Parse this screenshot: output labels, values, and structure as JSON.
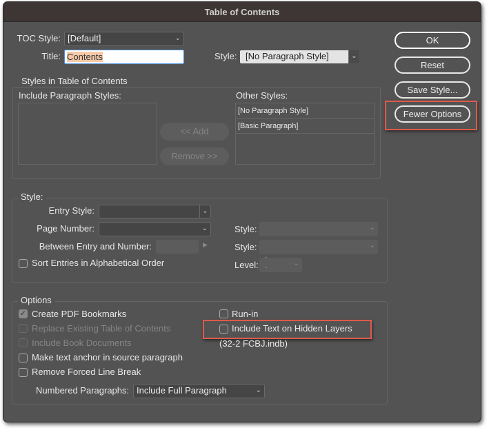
{
  "window": {
    "title": "Table of Contents"
  },
  "toc_style": {
    "label": "TOC Style:",
    "value": "[Default]"
  },
  "title": {
    "label": "Title:",
    "value": "Contents"
  },
  "title_style": {
    "label": "Style:",
    "value": "[No Paragraph Style]"
  },
  "buttons": {
    "ok": "OK",
    "reset": "Reset",
    "save_style": "Save Style...",
    "fewer_options": "Fewer Options",
    "add": "<< Add",
    "remove": "Remove >>"
  },
  "styles_group": {
    "label": "Styles in Table of Contents",
    "include_label": "Include Paragraph Styles:",
    "other_label": "Other Styles:",
    "other_items": [
      "[No Paragraph Style]",
      "[Basic Paragraph]"
    ]
  },
  "style_group": {
    "label": "Style:",
    "entry_style": "Entry Style:",
    "page_number": "Page Number:",
    "between": "Between Entry and Number:",
    "style1": "Style:",
    "style2": "Style:",
    "sort": "Sort Entries in Alphabetical Order",
    "level": "Level:"
  },
  "options": {
    "label": "Options",
    "create_pdf": "Create PDF Bookmarks",
    "replace": "Replace Existing Table of Contents",
    "include_book": "Include Book Documents",
    "make_anchor": "Make text anchor in source paragraph",
    "remove_break": "Remove Forced Line Break",
    "run_in": "Run-in",
    "hidden_layers": "Include Text on Hidden Layers",
    "book_file": "(32-2 FCBJ.indb)",
    "numbered_label": "Numbered Paragraphs:",
    "numbered_value": "Include Full Paragraph"
  }
}
